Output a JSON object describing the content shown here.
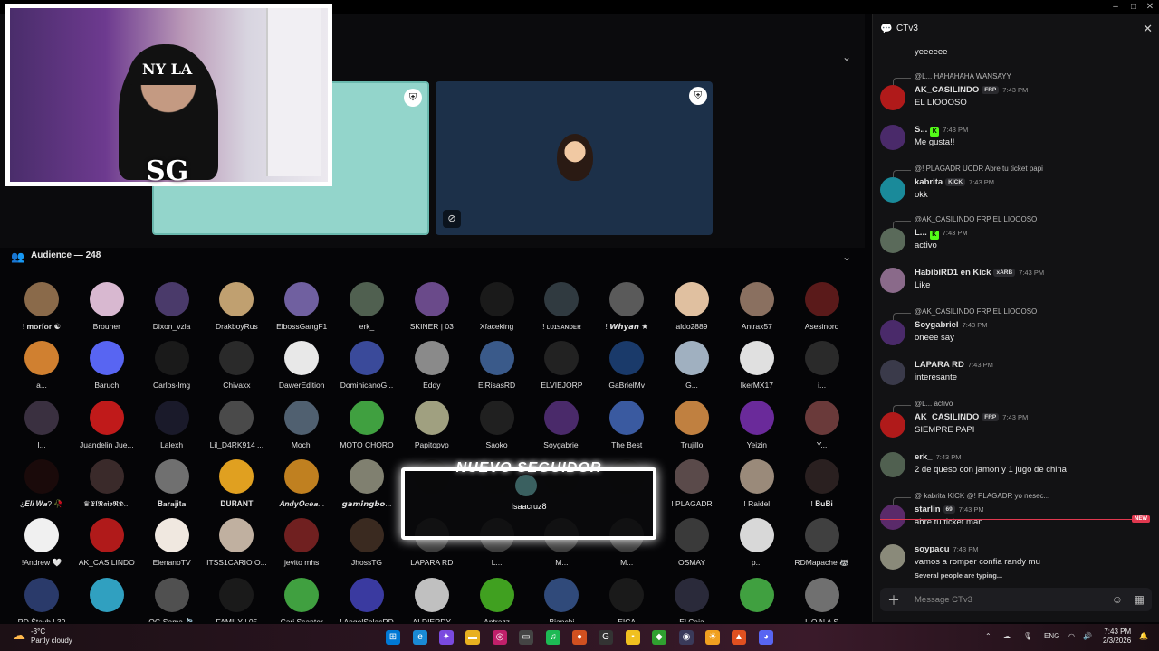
{
  "window": {
    "minimize": "–",
    "maximize": "□",
    "close": "✕"
  },
  "stage": {
    "badge_icon": "shield-icon",
    "mute_icon": "mic-off-icon"
  },
  "webcam": {
    "cap_logo": "NY LA",
    "overlay_logo": "SG"
  },
  "audience": {
    "title": "Audience — 248"
  },
  "members": [
    {
      "name": "! 𝐦𝐨𝐫𝐟𝐨𝐫 ☯",
      "color": "#8a6a4a"
    },
    {
      "name": "Brouner",
      "color": "#d8b8d0"
    },
    {
      "name": "Dixon_vzla",
      "color": "#4a3a6a"
    },
    {
      "name": "DrakboyRus",
      "color": "#c0a070"
    },
    {
      "name": "ElbossGangF1",
      "color": "#7060a0"
    },
    {
      "name": "erk_",
      "color": "#506050"
    },
    {
      "name": "SKINER | 03",
      "color": "#6a4a8a"
    },
    {
      "name": "Xfaceking",
      "color": "#1a1a1a"
    },
    {
      "name": "! ʟᴜɪꜱᴀɴᴅᴇʀ",
      "color": "#303a40"
    },
    {
      "name": "! 𝙒𝙝𝙮𝙖𝙣 ★",
      "color": "#5a5a5a"
    },
    {
      "name": "aldo2889",
      "color": "#e0c0a0"
    },
    {
      "name": "Antrax57",
      "color": "#8a7060"
    },
    {
      "name": "Asesinord",
      "color": "#5a1a1a"
    },
    {
      "name": "a...",
      "color": "#d08030"
    },
    {
      "name": "Baruch",
      "color": "#5865f2"
    },
    {
      "name": "Carlos-lmg",
      "color": "#1a1a1a"
    },
    {
      "name": "Chivaxx",
      "color": "#2a2a2a"
    },
    {
      "name": "DawerEdition",
      "color": "#e8e8e8"
    },
    {
      "name": "DominicanoG...",
      "color": "#3a4a9a"
    },
    {
      "name": "Eddy",
      "color": "#8a8a8a"
    },
    {
      "name": "ElRisasRD",
      "color": "#3a5a8a"
    },
    {
      "name": "ELVIEJORP",
      "color": "#222"
    },
    {
      "name": "GaBrielMv",
      "color": "#1a3a6a"
    },
    {
      "name": "G...",
      "color": "#a0b0c0"
    },
    {
      "name": "IkerMX17",
      "color": "#e0e0e0"
    },
    {
      "name": "i...",
      "color": "#2a2a2a"
    },
    {
      "name": "I...",
      "color": "#3a3040"
    },
    {
      "name": "Juandelin Jue...",
      "color": "#c01a1a"
    },
    {
      "name": "Lalexh",
      "color": "#1a1a2a"
    },
    {
      "name": "Lil_D4RK914 ...",
      "color": "#4a4a4a"
    },
    {
      "name": "Mochi",
      "color": "#506070"
    },
    {
      "name": "MOTO CHORO",
      "color": "#40a040"
    },
    {
      "name": "Papitopvp",
      "color": "#a0a080"
    },
    {
      "name": "Saoko",
      "color": "#202020"
    },
    {
      "name": "Soygabriel",
      "color": "#4a2a6a"
    },
    {
      "name": "The Best",
      "color": "#3a5aa0"
    },
    {
      "name": "Trujillo",
      "color": "#c08040"
    },
    {
      "name": "Yeizin",
      "color": "#6a2a9a"
    },
    {
      "name": "Y...",
      "color": "#6a3a3a"
    },
    {
      "name": "¿𝑬𝒍𝒊 𝑾𝒂? 🥀",
      "color": "#1a0a0a"
    },
    {
      "name": "♛𝕰𝖑𝕹𝖆𝖎𝖔𝕽𝕯...",
      "color": "#3a2a2a"
    },
    {
      "name": "𝐁𝐚𝐫𝐚𝐣𝐢𝐭𝐚",
      "color": "#707070"
    },
    {
      "name": "𝐃𝐔𝐑𝐀𝐍𝐓",
      "color": "#e0a020"
    },
    {
      "name": "𝑨𝒏𝒅𝒚𝑶𝒄𝒆𝒂...",
      "color": "#c08020"
    },
    {
      "name": "𝙜𝙖𝙢𝙞𝙣𝙜𝙗𝙤...",
      "color": "#808070"
    },
    {
      "name": "",
      "color": "#000"
    },
    {
      "name": "",
      "color": "#000"
    },
    {
      "name": "",
      "color": "#000"
    },
    {
      "name": "",
      "color": "#000"
    },
    {
      "name": "! PLAGADR",
      "color": "#5a4a4a"
    },
    {
      "name": "! Raidel",
      "color": "#9a8a7a"
    },
    {
      "name": "! 𝐁𝐮𝐁𝐢",
      "color": "#2a2020"
    },
    {
      "name": "!Andrew 🤍",
      "color": "#f0f0f0"
    },
    {
      "name": "AK_CASILINDO",
      "color": "#b01a1a"
    },
    {
      "name": "ElenanoTV",
      "color": "#f0e8e0"
    },
    {
      "name": "ITSS1CARIO O...",
      "color": "#c0b0a0"
    },
    {
      "name": "jevito mhs",
      "color": "#702020"
    },
    {
      "name": "JhossTG",
      "color": "#3a2a20"
    },
    {
      "name": "LAPARA RD",
      "color": "#3a3a3a"
    },
    {
      "name": "L...",
      "color": "#3a3a3a"
    },
    {
      "name": "M...",
      "color": "#3a3a3a"
    },
    {
      "name": "M...",
      "color": "#3a3a3a"
    },
    {
      "name": "OSMAY",
      "color": "#3a3a3a"
    },
    {
      "name": "p...",
      "color": "#d8d8d8"
    },
    {
      "name": "RDMapache 🦝",
      "color": "#404040"
    },
    {
      "name": "RD Štayh | 30",
      "color": "#2a3a6a"
    },
    {
      "name": "...",
      "color": "#30a0c0"
    },
    {
      "name": "OG Sama 🍃",
      "color": "#505050"
    },
    {
      "name": "FAMILY | 05",
      "color": "#1a1a1a"
    },
    {
      "name": "Cari Ssanter",
      "color": "#40a040"
    },
    {
      "name": "! AngelSalasRD",
      "color": "#3a3aa0"
    },
    {
      "name": "ALDIERDY",
      "color": "#c0c0c0"
    },
    {
      "name": "Antrazz",
      "color": "#40a020"
    },
    {
      "name": "Bianchi",
      "color": "#304a7a"
    },
    {
      "name": "EICA",
      "color": "#1a1a1a"
    },
    {
      "name": "El Caja",
      "color": "#2a2a3a"
    },
    {
      "name": "...",
      "color": "#40a040"
    },
    {
      "name": "L O N A S",
      "color": "#707070"
    }
  ],
  "follower_alert": {
    "title": "NUEVO SEGUIDOR",
    "name": "Isaacruz8"
  },
  "chat": {
    "title": "CTv3",
    "close": "✕",
    "messages": [
      {
        "text": "yeeeeee"
      },
      {
        "reply": "@L... HAHAHAHA WANSAYY",
        "user": "AK_CASILINDO",
        "badge": "FRP",
        "time": "7:43 PM",
        "text": "EL LIOOOSO",
        "color": "#e0e0e0",
        "avatar": "#b01a1a"
      },
      {
        "user": "S...",
        "kick": "K",
        "time": "7:43 PM",
        "text": "Me gusta!!",
        "color": "#e0e0e0",
        "avatar": "#4a2a6a"
      },
      {
        "reply": "@! PLAGADR  UCDR  Abre tu ticket papi",
        "user": "kabrita",
        "badge": "KICK",
        "time": "7:43 PM",
        "text": "okk",
        "color": "#e0e0e0",
        "avatar": "#1a8a9a"
      },
      {
        "reply": "@AK_CASILINDO  FRP  EL LIOOOSO",
        "user": "L...",
        "kick": "K",
        "time": "7:43 PM",
        "text": "activo",
        "color": "#e0e0e0",
        "avatar": "#5a6a5a"
      },
      {
        "user": "HabibiRD1 en Kick",
        "badge": "xARB",
        "time": "7:43 PM",
        "text": "Like",
        "color": "#e0e0e0",
        "avatar": "#8a6a8a"
      },
      {
        "reply": "@AK_CASILINDO  FRP  EL LIOOOSO",
        "user": "Soygabriel",
        "time": "7:43 PM",
        "text": "oneee say",
        "color": "#e0e0e0",
        "avatar": "#4a2a6a"
      },
      {
        "user": "LAPARA RD",
        "time": "7:43 PM",
        "text": "interesante",
        "color": "#e0e0e0",
        "avatar": "#3a3a4a"
      },
      {
        "reply": "@L... activo",
        "user": "AK_CASILINDO",
        "badge": "FRP",
        "time": "7:43 PM",
        "text": "SIEMPRE PAPI",
        "color": "#e0e0e0",
        "avatar": "#b01a1a"
      },
      {
        "user": "erk_",
        "time": "7:43 PM",
        "text": "2 de queso con jamon y 1 jugo de china",
        "color": "#e0e0e0",
        "avatar": "#506050"
      },
      {
        "reply": "@ kabrita  KICK  @! PLAGADR yo nesec...",
        "user": "starlin",
        "badge": "69",
        "time": "7:43 PM",
        "text": "abre tu ticket man",
        "color": "#e0e0e0",
        "avatar": "#5a2a6a"
      },
      {
        "user": "soypacu",
        "time": "7:43 PM",
        "text": "vamos a romper confia randy mu",
        "color": "#e0e0e0",
        "avatar": "#8a8a7a"
      }
    ],
    "new_tag": "NEW",
    "typing": "Several people are typing...",
    "input_placeholder": "Message CTv3"
  },
  "taskbar": {
    "temp": "-3°C",
    "weather": "Partly cloudy",
    "lang": "ENG",
    "time": "7:43 PM",
    "date": "2/3/2026"
  }
}
